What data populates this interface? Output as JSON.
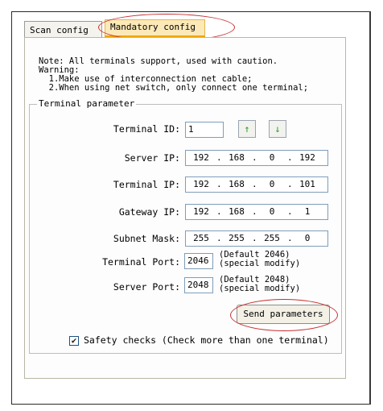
{
  "tabs": [
    {
      "label": "Scan config"
    },
    {
      "label": "Mandatory config"
    }
  ],
  "note": {
    "line1": "Note: All terminals support, used with caution.",
    "line2": "Warning:",
    "line3": "  1.Make use of interconnection net cable;",
    "line4": "  2.When using net switch, only connect one terminal;"
  },
  "group_title": "Terminal parameter",
  "terminal_id": {
    "label": "Terminal ID:",
    "value": "1"
  },
  "arrows": {
    "up": "↑",
    "down": "↓"
  },
  "server_ip": {
    "label": "Server IP:",
    "octets": [
      "192",
      "168",
      "0",
      "192"
    ]
  },
  "terminal_ip": {
    "label": "Terminal IP:",
    "octets": [
      "192",
      "168",
      "0",
      "101"
    ]
  },
  "gateway_ip": {
    "label": "Gateway IP:",
    "octets": [
      "192",
      "168",
      "0",
      "1"
    ]
  },
  "subnet_mask": {
    "label": "Subnet Mask:",
    "octets": [
      "255",
      "255",
      "255",
      "0"
    ]
  },
  "ip_dot": ".",
  "terminal_port": {
    "label": "Terminal Port:",
    "value": "2046",
    "note1": "(Default 2046)",
    "note2": "(special modify)"
  },
  "server_port": {
    "label": "Server Port:",
    "value": "2048",
    "note1": "(Default 2048)",
    "note2": "(special modify)"
  },
  "send_button": "Send parameters",
  "safety": {
    "checked": true,
    "mark": "✔",
    "label": "Safety checks (Check more than one terminal)"
  },
  "colors": {
    "active_tab": "#fce9b8",
    "highlight_oval": "#c83030",
    "arrow": "#2e9a2e"
  }
}
